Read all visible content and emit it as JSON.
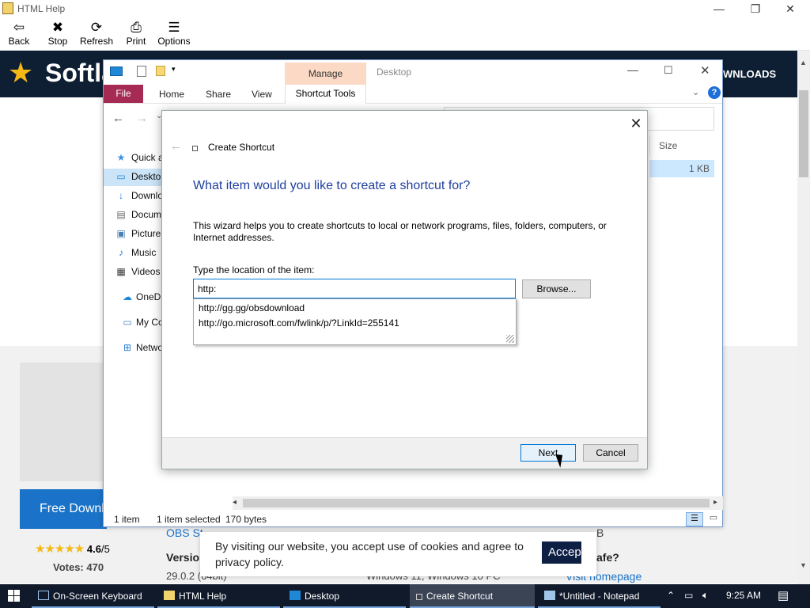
{
  "help_window": {
    "title": "HTML Help",
    "toolbar": [
      {
        "label": "Back",
        "icon": "back-arrow-icon",
        "glyph": "⇦"
      },
      {
        "label": "Stop",
        "icon": "stop-icon",
        "glyph": "✖"
      },
      {
        "label": "Refresh",
        "icon": "refresh-icon",
        "glyph": "⟳"
      },
      {
        "label": "Print",
        "icon": "printer-icon",
        "glyph": "⎙"
      },
      {
        "label": "Options",
        "icon": "options-icon",
        "glyph": "☰"
      }
    ]
  },
  "site": {
    "brand": "Softla",
    "downloads": "WNLOADS",
    "free_download": "Free Downlo",
    "rating_value": "4.6",
    "rating_suffix": "/5",
    "votes": "Votes: 470",
    "obs_label": "OBS St",
    "version_label": "Versio",
    "version_value": "29.0.2 (64bit)",
    "os_value": "Windows 11, Windows 10 PC",
    "b_text": "B",
    "safe_text": "afe?",
    "visit_homepage": "Visit homepage",
    "accent": "#1a73c8"
  },
  "explorer": {
    "manage_tab": "Manage",
    "location_title": "Desktop",
    "ribbon_tabs": [
      "File",
      "Home",
      "Share",
      "View",
      "Shortcut Tools"
    ],
    "sidebar": [
      {
        "label": "Quick access",
        "icon": "star-icon",
        "glyph": "★"
      },
      {
        "label": "Desktop",
        "icon": "desktop-icon",
        "glyph": "▭"
      },
      {
        "label": "Downloads",
        "icon": "download-icon",
        "glyph": "↓"
      },
      {
        "label": "Documents",
        "icon": "document-icon",
        "glyph": "▤"
      },
      {
        "label": "Pictures",
        "icon": "picture-icon",
        "glyph": "▣"
      },
      {
        "label": "Music",
        "icon": "music-icon",
        "glyph": "♪"
      },
      {
        "label": "Videos",
        "icon": "video-icon",
        "glyph": "▦"
      },
      {
        "label": "OneDrive",
        "icon": "cloud-icon",
        "glyph": "☁"
      },
      {
        "label": "My Computer",
        "icon": "computer-icon",
        "glyph": "▭"
      },
      {
        "label": "Network",
        "icon": "network-icon",
        "glyph": "⊞"
      }
    ],
    "size_column": "Size",
    "row_size": "1 KB",
    "status": {
      "count": "1 item",
      "selected": "1 item selected",
      "bytes": "170 bytes"
    }
  },
  "dialog": {
    "title": "Create Shortcut",
    "heading": "What item would you like to create a shortcut for?",
    "description": "This wizard helps you to create shortcuts to local or network programs, files, folders, computers, or Internet addresses.",
    "location_label": "Type the location of the item:",
    "location_value": "http:",
    "browse": "Browse...",
    "suggestions": [
      "http://gg.gg/obsdownload",
      "http://go.microsoft.com/fwlink/p/?LinkId=255141"
    ],
    "next": "Next",
    "cancel": "Cancel"
  },
  "cookie": {
    "text": "By visiting our website, you accept use of cookies and agree to privacy policy.",
    "accept": "Accep"
  },
  "taskbar": {
    "items": [
      {
        "label": "On-Screen Keyboard",
        "icon": "keyboard-icon"
      },
      {
        "label": "HTML Help",
        "icon": "help-icon"
      },
      {
        "label": "Desktop",
        "icon": "folder-icon"
      },
      {
        "label": "Create Shortcut",
        "icon": "shortcut-icon"
      },
      {
        "label": "*Untitled - Notepad",
        "icon": "notepad-icon"
      }
    ],
    "time": "9:25 AM"
  }
}
